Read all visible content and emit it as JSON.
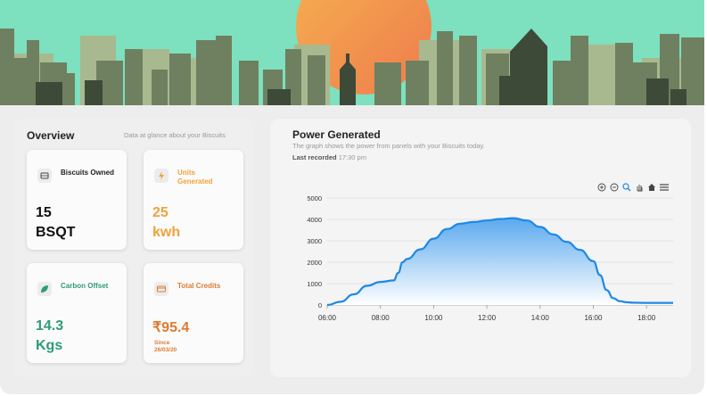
{
  "overview": {
    "title": "Overview",
    "subtitle": "Data at glance about your Biscuits",
    "cards": [
      {
        "label": "Biscuits Owned",
        "value": "15",
        "unit": "BSQT",
        "color": "#111111",
        "icon": "biscuit-icon"
      },
      {
        "label": "Units Generated",
        "value": "25",
        "unit": "kwh",
        "color": "#f0a23a",
        "icon": "lightning-icon"
      },
      {
        "label": "Carbon Offset",
        "value": "14.3",
        "unit": "Kgs",
        "color": "#2e9b78",
        "icon": "leaf-icon"
      },
      {
        "label": "Total Credits",
        "value": "₹95.4",
        "since_label": "Since",
        "since_date": "26/03/20",
        "color": "#de7b30",
        "icon": "credit-card-icon"
      }
    ]
  },
  "power": {
    "title": "Power Generated",
    "subtitle": "The graph shows the power from panels with your Biscuits today.",
    "last_recorded_label": "Last recorded",
    "last_recorded_value": "17:30 pm",
    "toolbar": [
      "zoom-in-icon",
      "zoom-out-icon",
      "magnify-icon",
      "pan-hand-icon",
      "home-icon",
      "menu-icon"
    ]
  },
  "chart_data": {
    "type": "area",
    "title": "",
    "xlabel": "",
    "ylabel": "",
    "xlim": [
      "06:00",
      "19:00"
    ],
    "ylim": [
      0,
      5000
    ],
    "x_ticks": [
      "06:00",
      "08:00",
      "10:00",
      "12:00",
      "14:00",
      "16:00",
      "18:00"
    ],
    "y_ticks": [
      "0",
      "1000",
      "2000",
      "3000",
      "4000",
      "5000"
    ],
    "grid": true,
    "series": [
      {
        "x": [
          "06:00",
          "06:30",
          "07:00",
          "07:30",
          "08:00",
          "08:30",
          "08:40",
          "08:50",
          "09:00",
          "09:30",
          "10:00",
          "10:30",
          "11:00",
          "11:30",
          "12:00",
          "12:30",
          "13:00",
          "13:30",
          "14:00",
          "14:30",
          "15:00",
          "15:30",
          "16:00",
          "16:15",
          "16:30",
          "16:45",
          "17:00",
          "17:15",
          "17:30",
          "18:00",
          "18:30",
          "19:00"
        ],
        "y": [
          0,
          150,
          500,
          900,
          1080,
          1150,
          1500,
          2000,
          2150,
          2600,
          3100,
          3550,
          3800,
          3880,
          3950,
          4020,
          4060,
          3950,
          3650,
          3300,
          2950,
          2580,
          2050,
          1400,
          700,
          320,
          180,
          130,
          110,
          100,
          100,
          100
        ],
        "color": "#1e88e5"
      }
    ]
  }
}
